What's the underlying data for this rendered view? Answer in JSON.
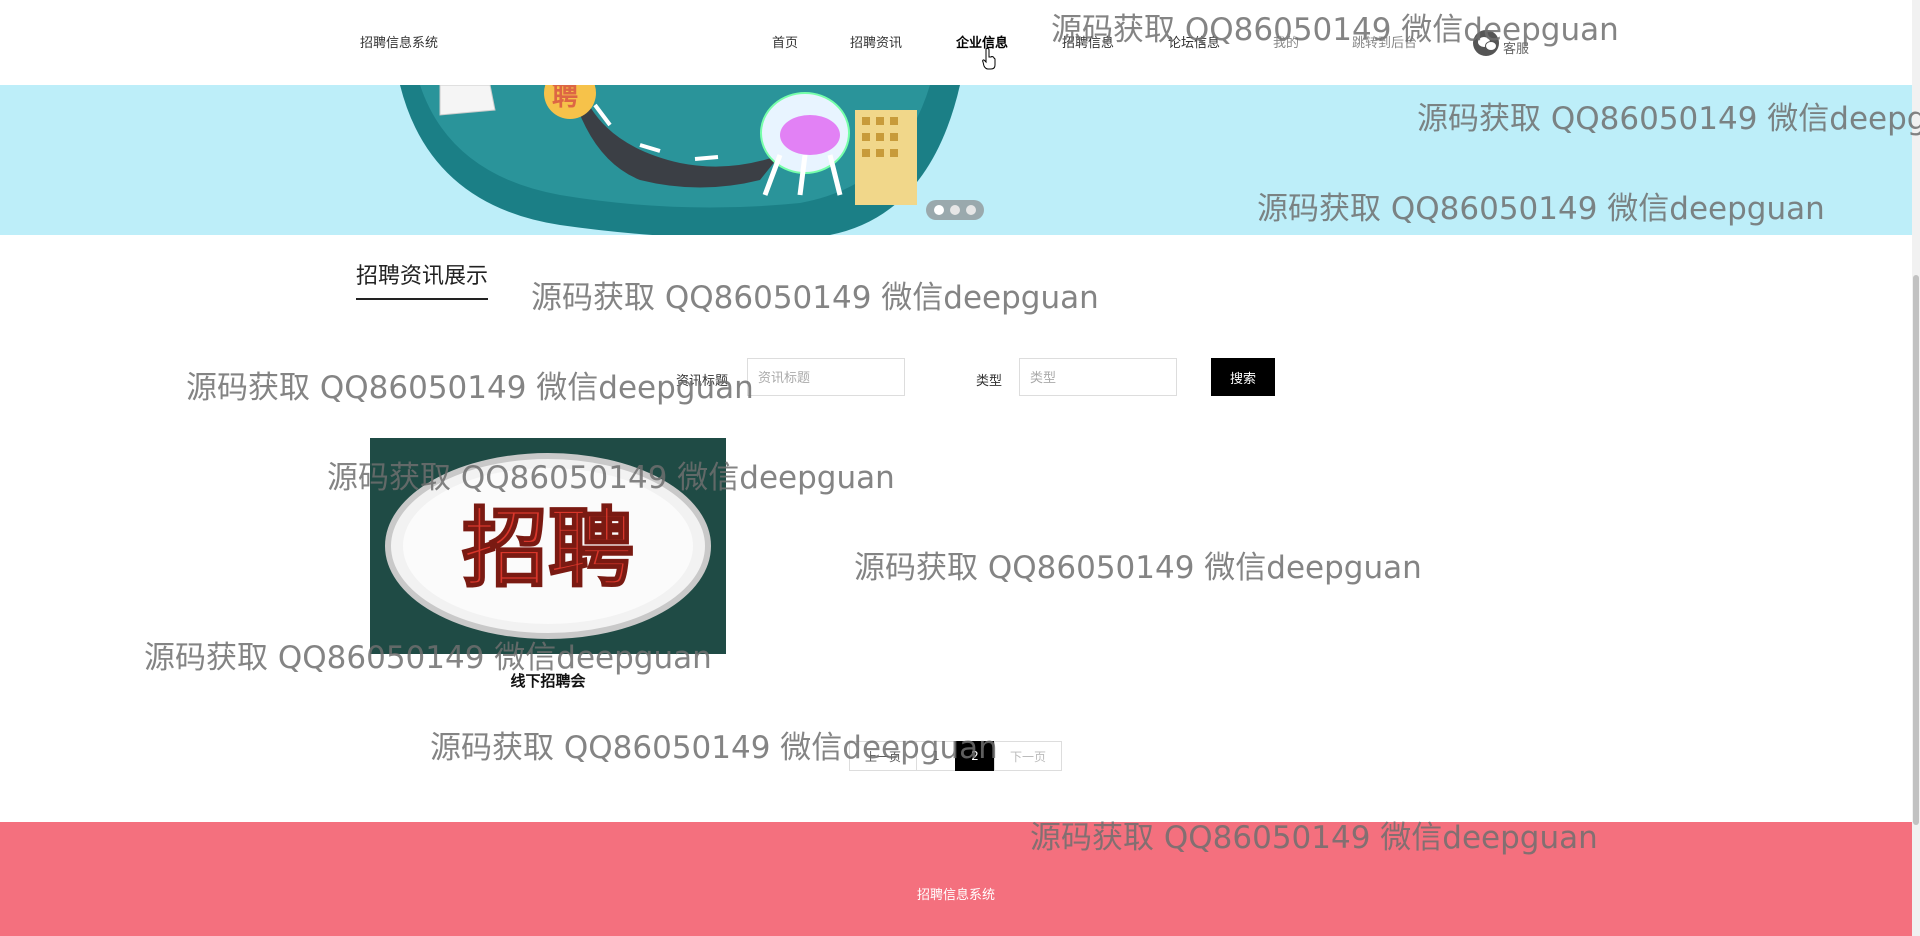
{
  "header": {
    "site_title": "招聘信息系统",
    "nav": [
      {
        "label": "首页",
        "state": "normal"
      },
      {
        "label": "招聘资讯",
        "state": "normal"
      },
      {
        "label": "企业信息",
        "state": "hover"
      },
      {
        "label": "招聘信息",
        "state": "normal"
      },
      {
        "label": "论坛信息",
        "state": "normal"
      },
      {
        "label": "我的",
        "state": "dim"
      },
      {
        "label": "跳转到后台",
        "state": "dim"
      }
    ],
    "kefu_label": "客服",
    "kefu_icon": "wechat-icon"
  },
  "banner": {
    "background": "#bdeef9",
    "badge_text": "聘",
    "slides": 3,
    "active_slide": 1
  },
  "section": {
    "title": "招聘资讯展示"
  },
  "search": {
    "title_label": "资讯标题",
    "title_placeholder": "资讯标题",
    "type_label": "类型",
    "type_placeholder": "类型",
    "button_label": "搜索"
  },
  "card": {
    "image_text": "招聘",
    "caption": "线下招聘会"
  },
  "pagination": {
    "prev": "上一页",
    "pages": [
      "1",
      "2"
    ],
    "current": "2",
    "next": "下一页"
  },
  "footer": {
    "text": "招聘信息系统",
    "background": "#f4707e"
  },
  "watermark": "源码获取 QQ86050149 微信deepguan"
}
